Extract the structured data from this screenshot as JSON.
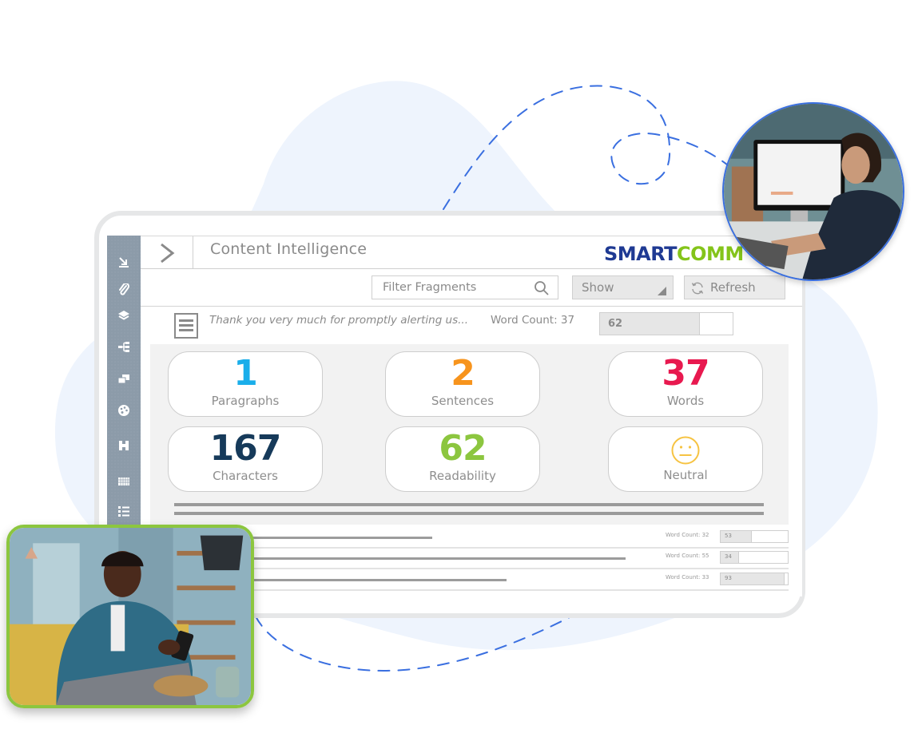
{
  "app": {
    "title": "Content Intelligence",
    "logo": {
      "part1": "SMART",
      "part2": "COMM",
      "mark": "™"
    }
  },
  "colors": {
    "logo_blue": "#1f3a93",
    "logo_green": "#84c41a",
    "rail": "#8c9ba9",
    "paragraphs": "#1aaeea",
    "sentences": "#f7941d",
    "words": "#e8194f",
    "characters": "#163a5a",
    "readability": "#8cc63f",
    "neutral": "#f6c342",
    "dashed_path": "#3a6fe0",
    "photo_frame_green": "#8cc63f"
  },
  "sidebar": {
    "items": [
      {
        "icon": "import-arrow-icon"
      },
      {
        "icon": "paperclip-icon"
      },
      {
        "icon": "layers-icon"
      },
      {
        "icon": "hierarchy-icon"
      },
      {
        "icon": "copy-stack-icon"
      },
      {
        "icon": "palette-icon"
      },
      {
        "icon": "binoculars-icon"
      },
      {
        "icon": "table-grid-icon"
      },
      {
        "icon": "list-icon"
      }
    ]
  },
  "toolbar": {
    "filter_placeholder": "Filter Fragments",
    "filter_value": "",
    "show_label": "Show",
    "refresh_label": "Refresh"
  },
  "fragment": {
    "text": "Thank you very much for promptly alerting us...",
    "word_count_label": "Word Count: 37",
    "score": "62",
    "score_fraction": 0.75
  },
  "metrics": [
    {
      "value": "1",
      "label": "Paragraphs",
      "color_key": "paragraphs"
    },
    {
      "value": "2",
      "label": "Sentences",
      "color_key": "sentences"
    },
    {
      "value": "37",
      "label": "Words",
      "color_key": "words"
    },
    {
      "value": "167",
      "label": "Characters",
      "color_key": "characters"
    },
    {
      "value": "62",
      "label": "Readability",
      "color_key": "readability"
    },
    {
      "value": "",
      "label": "Neutral",
      "color_key": "neutral",
      "icon": "neutral-face-icon"
    }
  ],
  "list": [
    {
      "word_count_label": "Word Count: 32",
      "score": "53",
      "score_fraction": 0.46,
      "text_fraction": 0.57
    },
    {
      "word_count_label": "Word Count: 55",
      "score": "34",
      "score_fraction": 0.27,
      "text_fraction": 0.96
    },
    {
      "word_count_label": "Word Count: 33",
      "score": "93",
      "score_fraction": 0.95,
      "text_fraction": 0.72
    }
  ],
  "photos": [
    {
      "subject": "woman working at desktop computer"
    },
    {
      "subject": "man on sofa using smartphone"
    }
  ]
}
